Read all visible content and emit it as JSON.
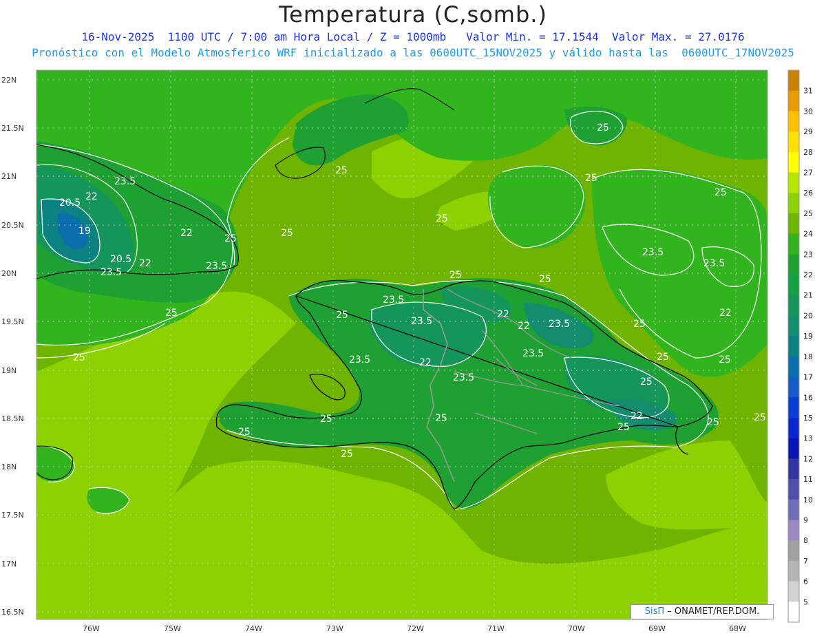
{
  "header": {
    "title": "Temperatura (C,somb.)",
    "line1": "16-Nov-2025  1100 UTC / 7:00 am Hora Local / Z = 1000mb   Valor Min. = 17.1544  Valor Max. = 27.0176",
    "line2": "Pronóstico con el Modelo Atmosferico WRF inicializado a las 0600UTC_15NOV2025 y válido hasta las  0600UTC_17NOV2025"
  },
  "axes": {
    "lat_labels": [
      "22N",
      "21.5N",
      "21N",
      "20.5N",
      "20N",
      "19.5N",
      "19N",
      "18.5N",
      "18N",
      "17.5N",
      "17N",
      "16.5N"
    ],
    "lon_labels": [
      "76W",
      "75W",
      "74W",
      "73W",
      "72W",
      "71W",
      "70W",
      "69W",
      "68W"
    ]
  },
  "colorbar": {
    "labels": [
      "31",
      "30",
      "29",
      "28",
      "27",
      "26",
      "25",
      "24",
      "23",
      "22",
      "21",
      "20",
      "19",
      "18",
      "17",
      "16",
      "15",
      "13",
      "12",
      "11",
      "10",
      "9",
      "8",
      "7",
      "6",
      "5"
    ],
    "colors": [
      "#c88200",
      "#e69b00",
      "#ffbe00",
      "#ffe100",
      "#ffff00",
      "#b4e600",
      "#8cd200",
      "#6eb400",
      "#32b41e",
      "#1ea032",
      "#14a046",
      "#14965a",
      "#148c6e",
      "#0a8282",
      "#0a6eaa",
      "#145ac8",
      "#0a3cd2",
      "#0a28c8",
      "#0a14b4",
      "#3232a0",
      "#5050aa",
      "#6e6eb4",
      "#9b87c3",
      "#a0a0a0",
      "#b4b4b4",
      "#d2d2d2",
      "#ffffff"
    ]
  },
  "contour_labels": [
    "25",
    "25",
    "25",
    "25",
    "25",
    "25",
    "25",
    "25",
    "25",
    "25",
    "25",
    "25",
    "25",
    "25",
    "25",
    "25",
    "25",
    "25",
    "25",
    "25",
    "25",
    "25",
    "25",
    "23.5",
    "23.5",
    "23.5",
    "23.5",
    "23.5",
    "23.5",
    "23.5",
    "23.5",
    "23.5",
    "23.5",
    "23.5",
    "22",
    "22",
    "22",
    "22",
    "22",
    "22",
    "22",
    "22",
    "20.5",
    "20.5",
    "19"
  ],
  "credit": {
    "brand": "SisΠ",
    "dash": "–",
    "org": "ONAMET/REP.DOM."
  }
}
